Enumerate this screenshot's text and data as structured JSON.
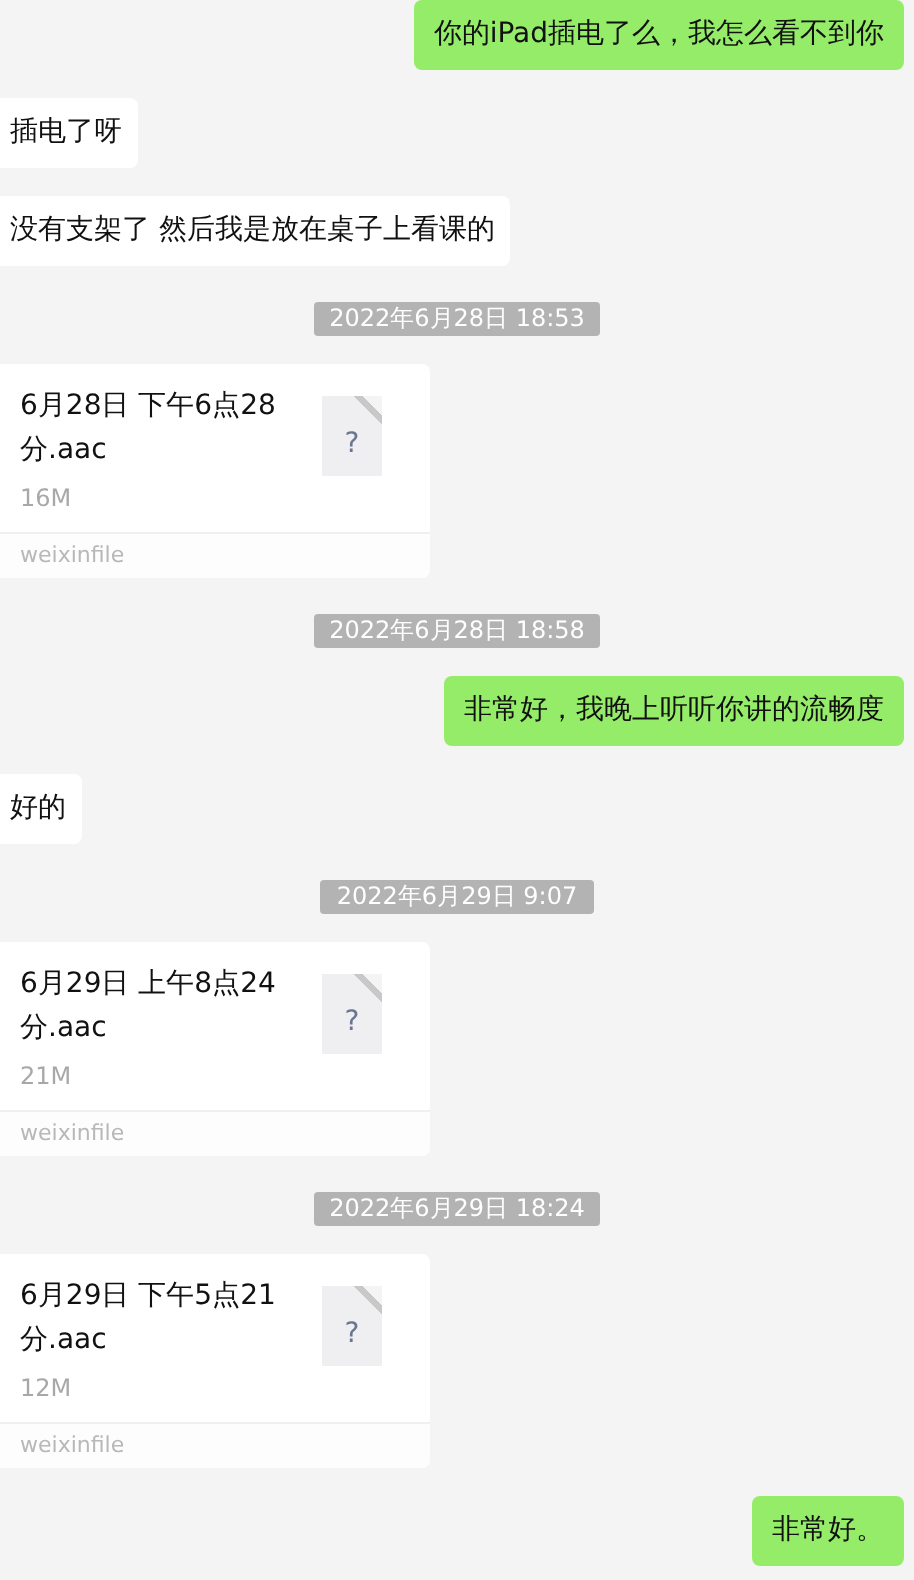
{
  "messages": [
    {
      "kind": "sent",
      "text": "你的iPad插电了么，我怎么看不到你"
    },
    {
      "kind": "received",
      "text": "插电了呀"
    },
    {
      "kind": "received",
      "text": "没有支架了 然后我是放在桌子上看课的"
    },
    {
      "kind": "time",
      "text": "2022年6月28日 18:53"
    },
    {
      "kind": "file",
      "name": "6月28日 下午6点28分.aac",
      "size": "16M",
      "icon_glyph": "?",
      "source": "weixinfile"
    },
    {
      "kind": "time",
      "text": "2022年6月28日 18:58"
    },
    {
      "kind": "sent",
      "text": "非常好，我晚上听听你讲的流畅度"
    },
    {
      "kind": "received",
      "text": "好的"
    },
    {
      "kind": "time",
      "text": "2022年6月29日 9:07"
    },
    {
      "kind": "file",
      "name": "6月29日 上午8点24分.aac",
      "size": "21M",
      "icon_glyph": "?",
      "source": "weixinfile"
    },
    {
      "kind": "time",
      "text": "2022年6月29日 18:24"
    },
    {
      "kind": "file",
      "name": "6月29日 下午5点21分.aac",
      "size": "12M",
      "icon_glyph": "?",
      "source": "weixinfile"
    },
    {
      "kind": "sent",
      "text": "非常好。"
    }
  ]
}
